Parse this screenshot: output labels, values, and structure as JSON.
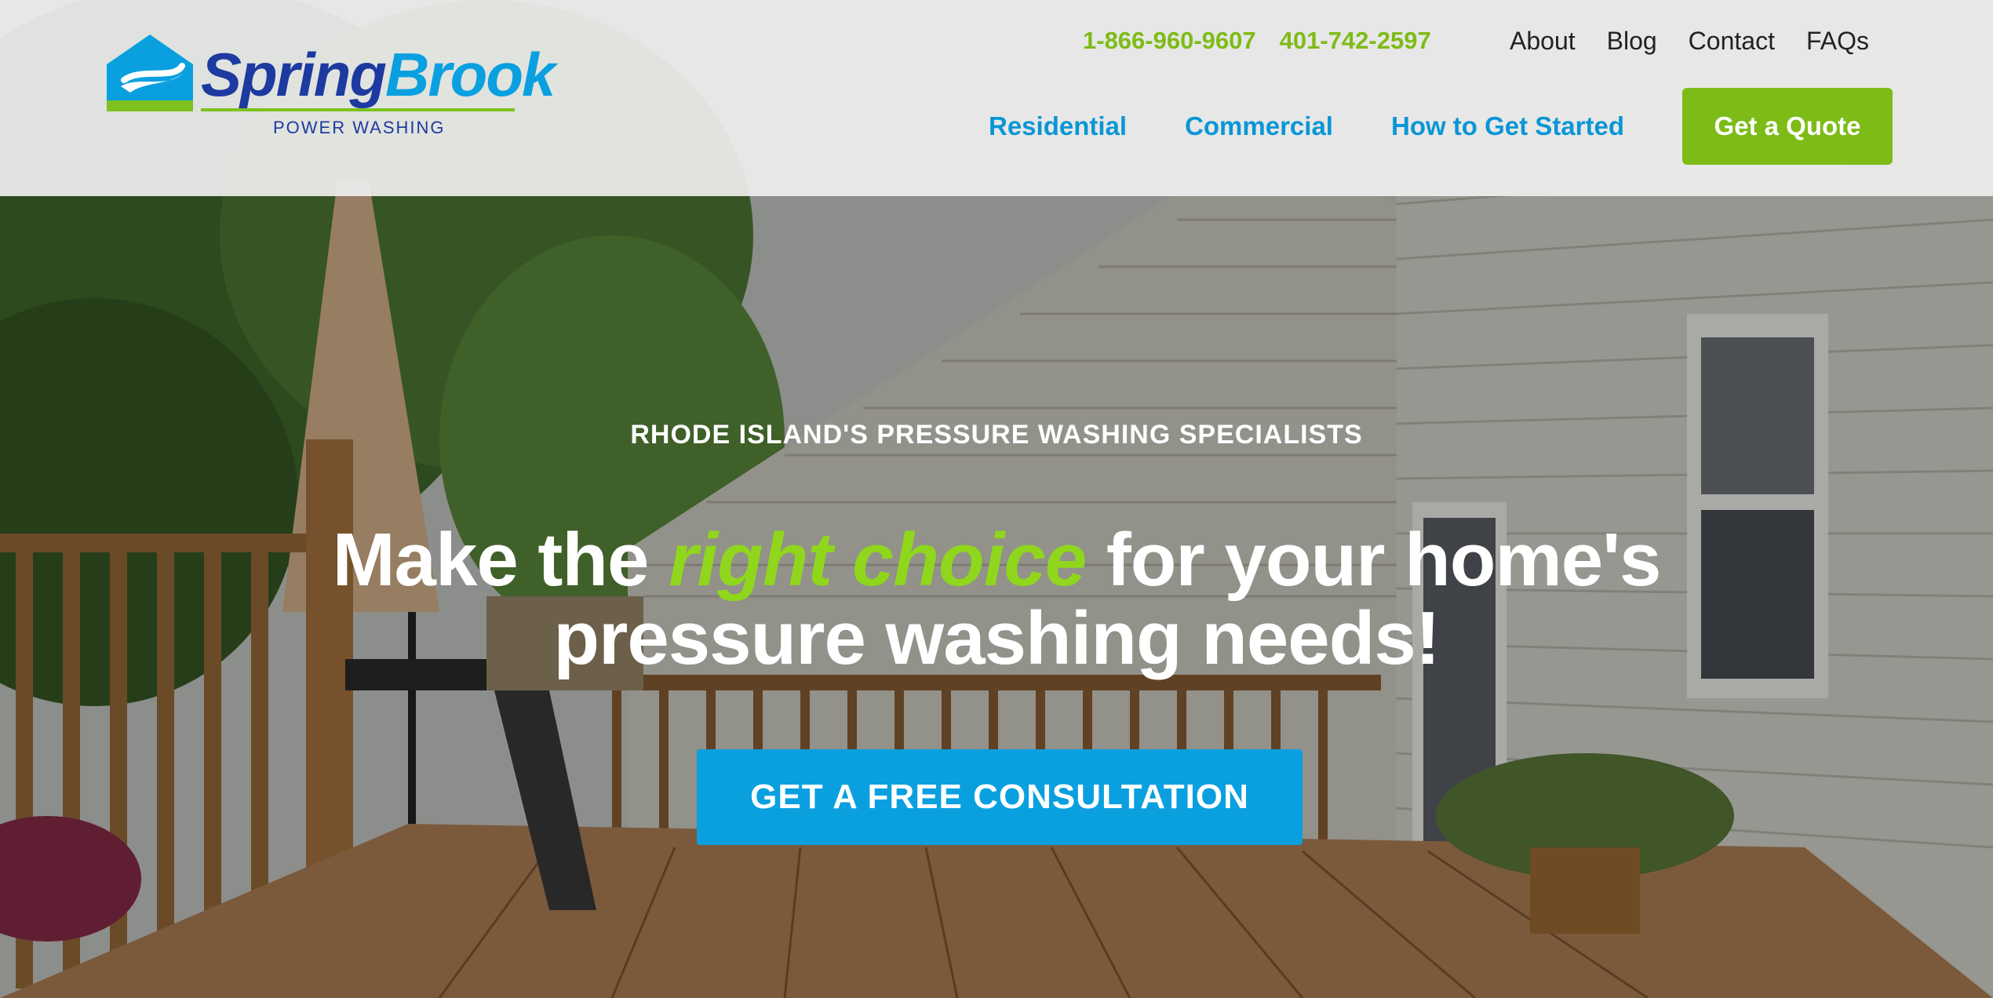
{
  "brand": {
    "name_part1": "Spring",
    "name_part2": "Brook",
    "tagline": "POWER WASHING",
    "colors": {
      "blue_dark": "#1d3aa0",
      "blue": "#0aa0e0",
      "green": "#7dbc17"
    }
  },
  "header": {
    "phones": [
      "1-866-960-9607",
      "401-742-2597"
    ],
    "utility_nav": [
      "About",
      "Blog",
      "Contact",
      "FAQs"
    ],
    "main_nav": [
      "Residential",
      "Commercial",
      "How to Get Started"
    ],
    "quote_button": "Get a Quote"
  },
  "hero": {
    "eyebrow": "RHODE ISLAND'S PRESSURE WASHING SPECIALISTS",
    "headline_before": "Make the ",
    "headline_accent": "right choice",
    "headline_after": " for your home's",
    "headline_line2": "pressure washing needs!",
    "cta": "GET A FREE CONSULTATION"
  }
}
